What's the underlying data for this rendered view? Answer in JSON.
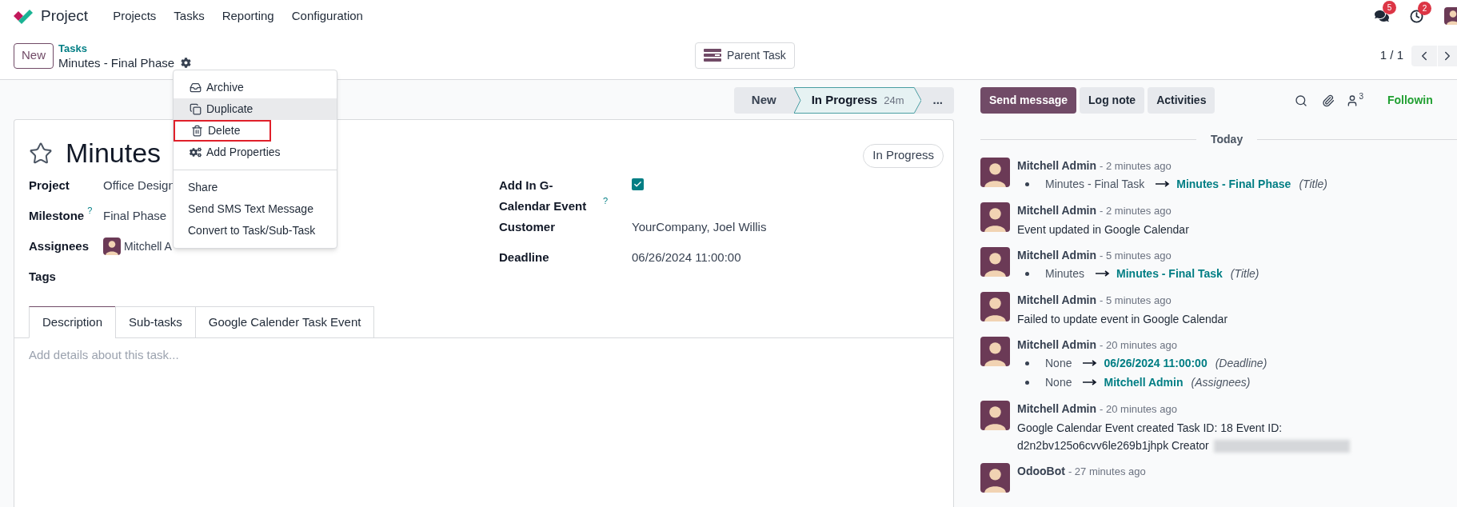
{
  "navbar": {
    "app_name": "Project",
    "menu": [
      "Projects",
      "Tasks",
      "Reporting",
      "Configuration"
    ],
    "messages_badge": "5",
    "activities_badge": "2"
  },
  "control_panel": {
    "new_button": "New",
    "breadcrumb": "Tasks",
    "record_name": "Minutes - Final Phase",
    "parent_task_button": "Parent Task",
    "pager": "1 / 1"
  },
  "gear_menu": {
    "sections": [
      {
        "items": [
          {
            "label": "Archive",
            "kind": "archive",
            "selected": false,
            "marked": false
          },
          {
            "label": "Duplicate",
            "kind": "duplicate",
            "selected": true,
            "marked": false
          },
          {
            "label": "Delete",
            "kind": "delete",
            "selected": false,
            "marked": true
          },
          {
            "label": "Add Properties",
            "kind": "properties",
            "selected": false,
            "marked": false
          }
        ]
      },
      {
        "items": [
          {
            "label": "Share",
            "kind": "text",
            "selected": false,
            "marked": false
          },
          {
            "label": "Send SMS Text Message",
            "kind": "text",
            "selected": false,
            "marked": false
          },
          {
            "label": "Convert to Task/Sub-Task",
            "kind": "text",
            "selected": false,
            "marked": false
          }
        ]
      }
    ]
  },
  "statusbar": {
    "stages": [
      {
        "label": "New",
        "selected": false
      },
      {
        "label": "In Progress",
        "duration": "24m",
        "selected": true
      }
    ],
    "more": "..."
  },
  "task": {
    "starred": false,
    "title": "Minutes",
    "state_badge": "In Progress"
  },
  "fields_left": [
    {
      "label": "Project",
      "kind": "text",
      "value": "Office Design"
    },
    {
      "label": "Milestone",
      "help": "?",
      "kind": "text",
      "value": "Final Phase"
    },
    {
      "label": "Assignees",
      "kind": "avatar",
      "value": "Mitchell A"
    },
    {
      "label": "Tags",
      "kind": "empty"
    }
  ],
  "fields_right": [
    {
      "label": "Add In G-Calendar Event",
      "help": "?",
      "kind": "checkbox",
      "checked": true
    },
    {
      "label": "Customer",
      "kind": "text",
      "value": "YourCompany, Joel Willis"
    },
    {
      "label": "Deadline",
      "kind": "text",
      "value": "06/26/2024 11:00:00"
    }
  ],
  "tabs": [
    {
      "label": "Description",
      "selected": true
    },
    {
      "label": "Sub-tasks",
      "selected": false
    },
    {
      "label": "Google Calender Task Event",
      "selected": false
    }
  ],
  "description_placeholder": "Add details about this task...",
  "chatter": {
    "buttons": [
      {
        "label": "Send message",
        "selected": true
      },
      {
        "label": "Log note",
        "selected": false
      },
      {
        "label": "Activities",
        "selected": false
      }
    ],
    "followers_count": "3",
    "follow_label": "Followin",
    "date_separator": "Today",
    "messages": [
      {
        "author": "Mitchell Admin",
        "time": "- 2 minutes ago",
        "kind": "tracking",
        "changes": [
          {
            "old": "Minutes - Final Task",
            "new": "Minutes - Final Phase",
            "field": "(Title)"
          }
        ]
      },
      {
        "author": "Mitchell Admin",
        "time": "- 2 minutes ago",
        "kind": "text",
        "body": "Event updated in Google Calendar"
      },
      {
        "author": "Mitchell Admin",
        "time": "- 5 minutes ago",
        "kind": "tracking",
        "changes": [
          {
            "old": "Minutes",
            "new": "Minutes - Final Task",
            "field": "(Title)"
          }
        ]
      },
      {
        "author": "Mitchell Admin",
        "time": "- 5 minutes ago",
        "kind": "text",
        "body": "Failed to update event in Google Calendar"
      },
      {
        "author": "Mitchell Admin",
        "time": "- 20 minutes ago",
        "kind": "tracking",
        "changes": [
          {
            "old": "None",
            "new": "06/26/2024 11:00:00",
            "field": "(Deadline)"
          },
          {
            "old": "None",
            "new": "Mitchell Admin",
            "field": "(Assignees)"
          }
        ]
      },
      {
        "author": "Mitchell Admin",
        "time": "- 20 minutes ago",
        "kind": "redacted",
        "body": "Google Calendar Event created Task ID: 18 Event ID: d2n2bv125o6cvv6le269b1jhpk Creator"
      },
      {
        "author": "OdooBot",
        "time": "- 27 minutes ago",
        "kind": "text"
      }
    ]
  }
}
